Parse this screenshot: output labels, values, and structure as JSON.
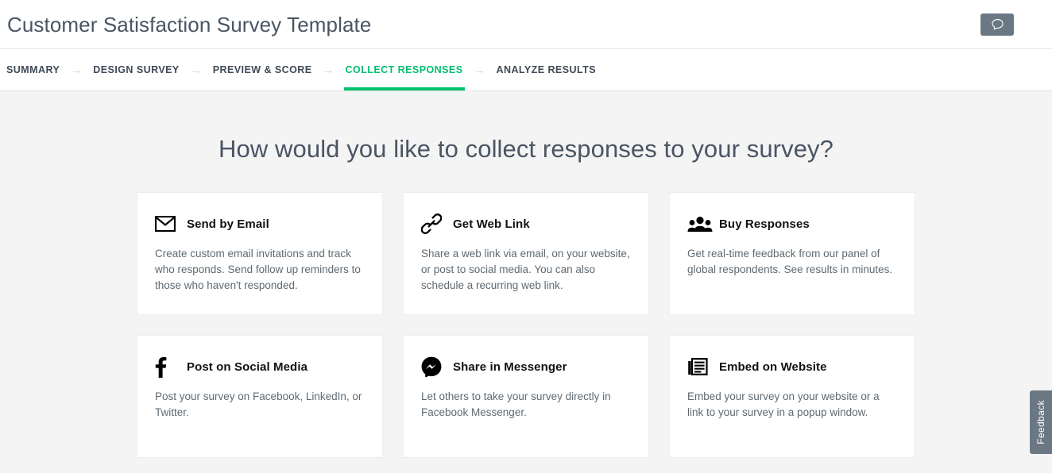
{
  "header": {
    "title": "Customer Satisfaction Survey Template",
    "comment_button": {
      "icon": "comment-bubble-icon",
      "label": ""
    },
    "accent_color": "#00bf6f",
    "button_color": "#6b7884"
  },
  "step_nav": {
    "arrow_glyph": "→",
    "steps": [
      {
        "label": "SUMMARY",
        "active": false
      },
      {
        "label": "DESIGN SURVEY",
        "active": false
      },
      {
        "label": "PREVIEW & SCORE",
        "active": false
      },
      {
        "label": "COLLECT RESPONSES",
        "active": true
      },
      {
        "label": "ANALYZE RESULTS",
        "active": false
      }
    ]
  },
  "main": {
    "headline": "How would you like to collect responses to your survey?",
    "cards": [
      {
        "icon": "envelope-icon",
        "title": "Send by Email",
        "description": "Create custom email invitations and track who responds. Send follow up reminders to those who haven't responded."
      },
      {
        "icon": "chain-link-icon",
        "title": "Get Web Link",
        "description": "Share a web link via email, on your website, or post to social media. You can also schedule a recurring web link."
      },
      {
        "icon": "people-group-icon",
        "title": "Buy Responses",
        "description": "Get real-time feedback from our panel of global respondents. See results in minutes."
      },
      {
        "icon": "facebook-f-icon",
        "title": "Post on Social Media",
        "description": "Post your survey on Facebook, LinkedIn, or Twitter."
      },
      {
        "icon": "messenger-icon",
        "title": "Share in Messenger",
        "description": "Let others to take your survey directly in Facebook Messenger."
      },
      {
        "icon": "embed-document-icon",
        "title": "Embed on Website",
        "description": "Embed your survey on your website or a link to your survey in a popup window."
      }
    ]
  },
  "feedback_tab": {
    "label": "Feedback"
  }
}
